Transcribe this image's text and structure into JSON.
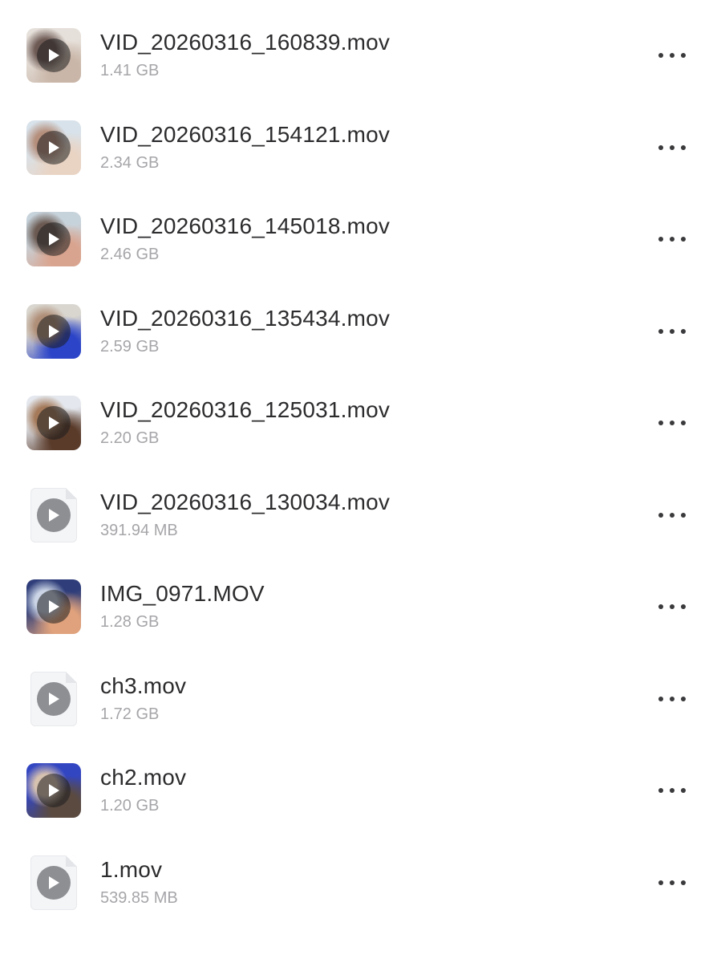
{
  "files": [
    {
      "name": "VID_20260316_160839.mov",
      "size": "1.41 GB",
      "thumb": "video",
      "thumb_colors": [
        "#e6e0da",
        "#6e5a55",
        "#c9b6a8"
      ]
    },
    {
      "name": "VID_20260316_154121.mov",
      "size": "2.34 GB",
      "thumb": "video",
      "thumb_colors": [
        "#d8e2ea",
        "#b58f7c",
        "#e9d4c4"
      ]
    },
    {
      "name": "VID_20260316_145018.mov",
      "size": "2.46 GB",
      "thumb": "video",
      "thumb_colors": [
        "#c7d3db",
        "#6b5a52",
        "#d9a48f"
      ]
    },
    {
      "name": "VID_20260316_135434.mov",
      "size": "2.59 GB",
      "thumb": "video",
      "thumb_colors": [
        "#d9d6cf",
        "#b08f78",
        "#2b44c8"
      ]
    },
    {
      "name": "VID_20260316_125031.mov",
      "size": "2.20 GB",
      "thumb": "video",
      "thumb_colors": [
        "#e4e8ee",
        "#a47a5a",
        "#5a3b2a"
      ]
    },
    {
      "name": "VID_20260316_130034.mov",
      "size": "391.94 MB",
      "thumb": "doc",
      "thumb_colors": []
    },
    {
      "name": "IMG_0971.MOV",
      "size": "1.28 GB",
      "thumb": "video",
      "thumb_colors": [
        "#2f3e7a",
        "#cbd5e6",
        "#e0a27c"
      ]
    },
    {
      "name": "ch3.mov",
      "size": "1.72 GB",
      "thumb": "doc",
      "thumb_colors": []
    },
    {
      "name": "ch2.mov",
      "size": "1.20 GB",
      "thumb": "video",
      "thumb_colors": [
        "#3346c2",
        "#d7c2b0",
        "#5a4a40"
      ]
    },
    {
      "name": "1.mov",
      "size": "539.85 MB",
      "thumb": "doc",
      "thumb_colors": []
    }
  ],
  "icons": {
    "play": "play-icon",
    "more": "more-icon"
  }
}
